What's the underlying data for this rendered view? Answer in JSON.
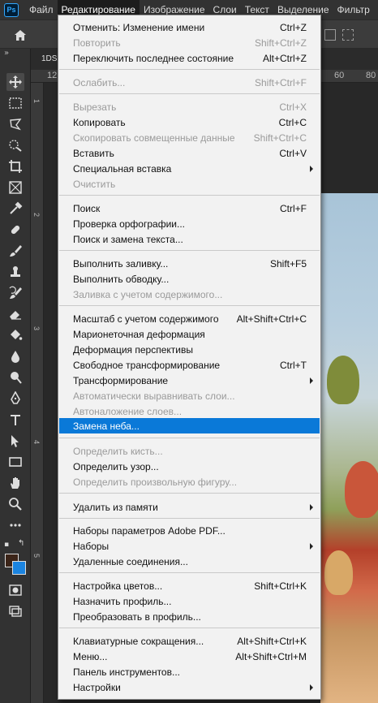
{
  "app": {
    "logo_text": "Ps"
  },
  "menubar": {
    "items": [
      {
        "label": "Файл"
      },
      {
        "label": "Редактирование"
      },
      {
        "label": "Изображение"
      },
      {
        "label": "Слои"
      },
      {
        "label": "Текст"
      },
      {
        "label": "Выделение"
      },
      {
        "label": "Фильтр"
      }
    ]
  },
  "document": {
    "tab_label": "1DS",
    "ruler_top": [
      "12",
      "60",
      "80"
    ],
    "ruler_left": [
      "1",
      "2",
      "3",
      "4",
      "5"
    ]
  },
  "colors": {
    "accent_highlight": "#0a79d8",
    "foreground_swatch": "#3b2418",
    "background_swatch": "#1b84e0",
    "menubar_bg": "#323232",
    "menu_bg": "#f2f2f2"
  },
  "edit_menu": {
    "items": [
      {
        "label": "Отменить: Изменение имени",
        "shortcut": "Ctrl+Z",
        "disabled": false
      },
      {
        "label": "Повторить",
        "shortcut": "Shift+Ctrl+Z",
        "disabled": true
      },
      {
        "label": "Переключить последнее состояние",
        "shortcut": "Alt+Ctrl+Z",
        "disabled": false
      },
      {
        "label": "Ослабить...",
        "shortcut": "Shift+Ctrl+F",
        "disabled": true
      },
      {
        "label": "Вырезать",
        "shortcut": "Ctrl+X",
        "disabled": true
      },
      {
        "label": "Копировать",
        "shortcut": "Ctrl+C",
        "disabled": false
      },
      {
        "label": "Скопировать совмещенные данные",
        "shortcut": "Shift+Ctrl+C",
        "disabled": true
      },
      {
        "label": "Вставить",
        "shortcut": "Ctrl+V",
        "disabled": false
      },
      {
        "label": "Специальная вставка",
        "shortcut": "",
        "disabled": false,
        "submenu": true
      },
      {
        "label": "Очистить",
        "shortcut": "",
        "disabled": true
      },
      {
        "label": "Поиск",
        "shortcut": "Ctrl+F",
        "disabled": false
      },
      {
        "label": "Проверка орфографии...",
        "shortcut": "",
        "disabled": false
      },
      {
        "label": "Поиск и замена текста...",
        "shortcut": "",
        "disabled": false
      },
      {
        "label": "Выполнить заливку...",
        "shortcut": "Shift+F5",
        "disabled": false
      },
      {
        "label": "Выполнить обводку...",
        "shortcut": "",
        "disabled": false
      },
      {
        "label": "Заливка с учетом содержимого...",
        "shortcut": "",
        "disabled": true
      },
      {
        "label": "Масштаб с учетом содержимого",
        "shortcut": "Alt+Shift+Ctrl+C",
        "disabled": false
      },
      {
        "label": "Марионеточная деформация",
        "shortcut": "",
        "disabled": false
      },
      {
        "label": "Деформация перспективы",
        "shortcut": "",
        "disabled": false
      },
      {
        "label": "Свободное трансформирование",
        "shortcut": "Ctrl+T",
        "disabled": false
      },
      {
        "label": "Трансформирование",
        "shortcut": "",
        "disabled": false,
        "submenu": true
      },
      {
        "label": "Автоматически выравнивать слои...",
        "shortcut": "",
        "disabled": true
      },
      {
        "label": "Автоналожение слоев...",
        "shortcut": "",
        "disabled": true
      },
      {
        "label": "Замена неба...",
        "shortcut": "",
        "disabled": false,
        "highlighted": true
      },
      {
        "label": "Определить кисть...",
        "shortcut": "",
        "disabled": true
      },
      {
        "label": "Определить узор...",
        "shortcut": "",
        "disabled": false
      },
      {
        "label": "Определить произвольную фигуру...",
        "shortcut": "",
        "disabled": true
      },
      {
        "label": "Удалить из памяти",
        "shortcut": "",
        "disabled": false,
        "submenu": true
      },
      {
        "label": "Наборы параметров Adobe PDF...",
        "shortcut": "",
        "disabled": false
      },
      {
        "label": "Наборы",
        "shortcut": "",
        "disabled": false,
        "submenu": true
      },
      {
        "label": "Удаленные соединения...",
        "shortcut": "",
        "disabled": false
      },
      {
        "label": "Настройка цветов...",
        "shortcut": "Shift+Ctrl+K",
        "disabled": false
      },
      {
        "label": "Назначить профиль...",
        "shortcut": "",
        "disabled": false
      },
      {
        "label": "Преобразовать в профиль...",
        "shortcut": "",
        "disabled": false
      },
      {
        "label": "Клавиатурные сокращения...",
        "shortcut": "Alt+Shift+Ctrl+K",
        "disabled": false
      },
      {
        "label": "Меню...",
        "shortcut": "Alt+Shift+Ctrl+M",
        "disabled": false
      },
      {
        "label": "Панель инструментов...",
        "shortcut": "",
        "disabled": false
      },
      {
        "label": "Настройки",
        "shortcut": "",
        "disabled": false,
        "submenu": true
      }
    ]
  },
  "tools": [
    {
      "icon": "move-icon"
    },
    {
      "icon": "marquee-icon"
    },
    {
      "icon": "lasso-icon"
    },
    {
      "icon": "quick-selection-icon"
    },
    {
      "icon": "crop-icon"
    },
    {
      "icon": "frame-icon"
    },
    {
      "icon": "eyedropper-icon"
    },
    {
      "icon": "healing-brush-icon"
    },
    {
      "icon": "brush-icon"
    },
    {
      "icon": "clone-stamp-icon"
    },
    {
      "icon": "history-brush-icon"
    },
    {
      "icon": "eraser-icon"
    },
    {
      "icon": "paint-bucket-icon"
    },
    {
      "icon": "blur-icon"
    },
    {
      "icon": "dodge-icon"
    },
    {
      "icon": "pen-icon"
    },
    {
      "icon": "type-icon"
    },
    {
      "icon": "path-selection-icon"
    },
    {
      "icon": "rectangle-icon"
    },
    {
      "icon": "hand-icon"
    },
    {
      "icon": "zoom-icon"
    },
    {
      "icon": "more-tools-icon"
    }
  ]
}
